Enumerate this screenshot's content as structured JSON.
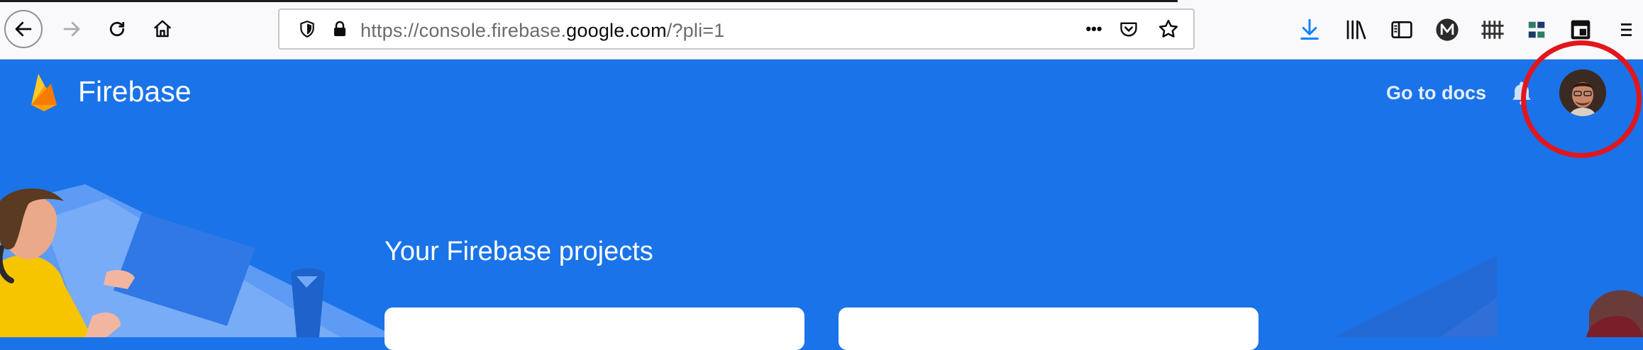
{
  "browser": {
    "url_prefix": "https://console.firebase.",
    "url_domain": "google.com",
    "url_suffix": "/?pli=1",
    "menu_dots": "•••"
  },
  "app": {
    "title": "Firebase",
    "go_to_docs": "Go to docs"
  },
  "main": {
    "heading": "Your Firebase projects"
  },
  "colors": {
    "brand_blue": "#1a73e8",
    "highlight_red": "#e3161b",
    "firebase_yellow": "#ffca28",
    "firebase_orange": "#f57c00"
  },
  "icons": [
    "back-icon",
    "forward-icon",
    "reload-icon",
    "home-icon",
    "shield-icon",
    "lock-icon",
    "more-icon",
    "pocket-icon",
    "star-icon",
    "download-icon",
    "library-icon",
    "sidebar-icon",
    "m-extension-icon",
    "grid-extension-icon",
    "green-extension-icon",
    "dark-extension-icon",
    "menu-icon",
    "firebase-flame-icon",
    "bell-icon"
  ]
}
